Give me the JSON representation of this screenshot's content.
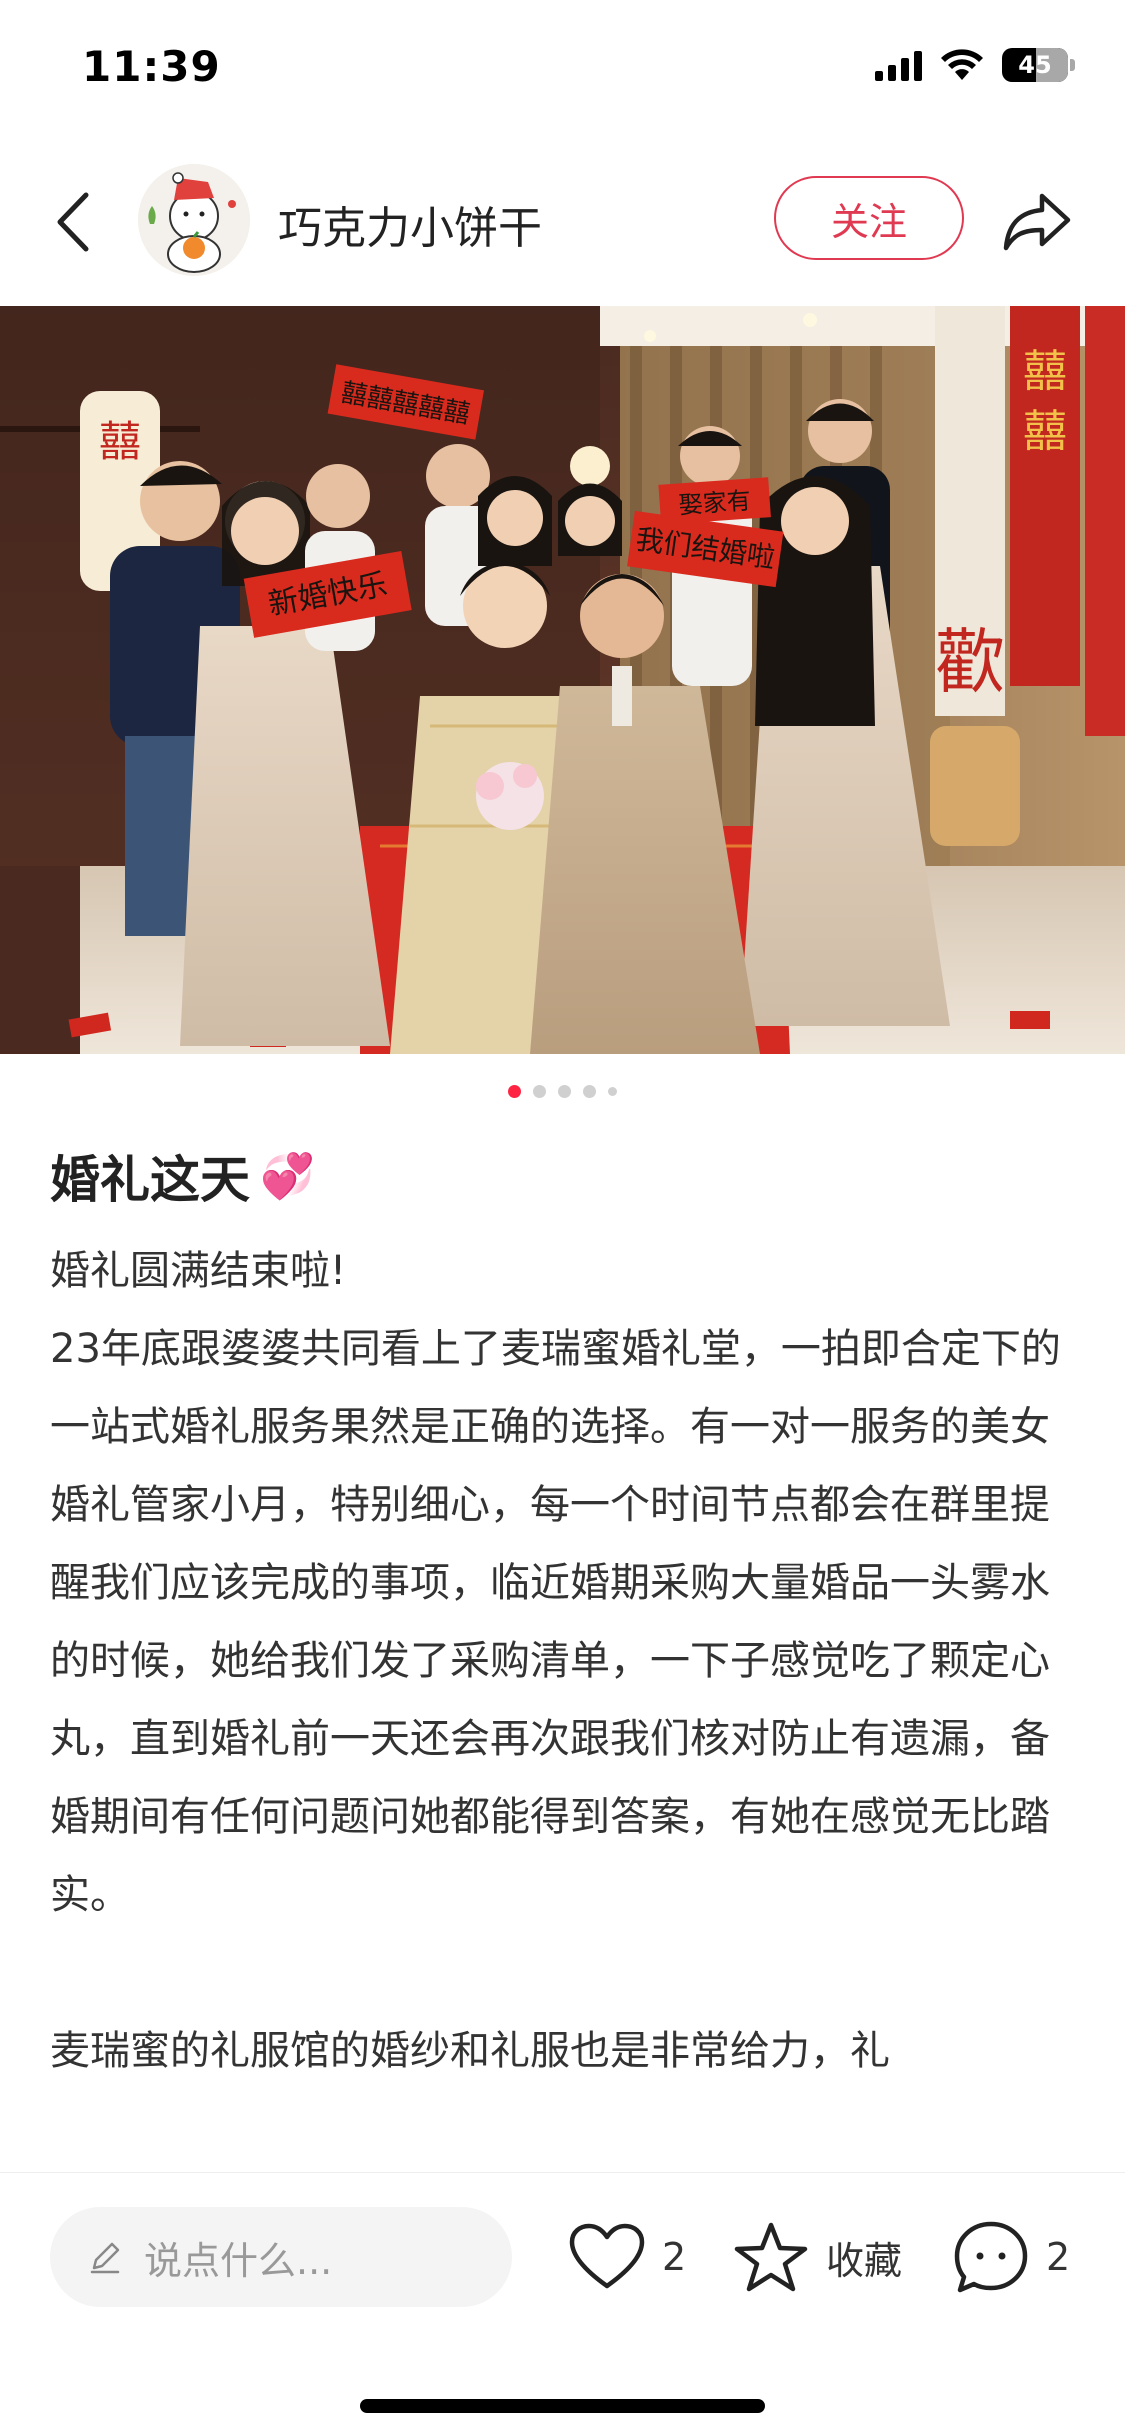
{
  "status_bar": {
    "time": "11:39",
    "battery": "45",
    "icons": [
      "signal-icon",
      "wifi-icon",
      "battery-icon"
    ]
  },
  "header": {
    "username": "巧克力小饼干",
    "follow_label": "关注",
    "icons": [
      "back-arrow-icon",
      "share-icon"
    ]
  },
  "photo": {
    "banner_left": "新婚快乐",
    "banner_top": "囍囍囍囍囍",
    "banner_right_top": "娶家有",
    "banner_right": "我们结婚啦",
    "lantern": "囍",
    "wall_big": "歡",
    "wall_scroll": "囍"
  },
  "carousel": {
    "count": 5,
    "active_index": 0
  },
  "post": {
    "title": "婚礼这天",
    "title_emoji": "💞",
    "body": "婚礼圆满结束啦!\n23年底跟婆婆共同看上了麦瑞蜜婚礼堂，一拍即合定下的一站式婚礼服务果然是正确的选择。有一对一服务的美女婚礼管家小月，特别细心，每一个时间节点都会在群里提醒我们应该完成的事项，临近婚期采购大量婚品一头雾水的时候，她给我们发了采购清单，一下子感觉吃了颗定心丸，直到婚礼前一天还会再次跟我们核对防止有遗漏，备婚期间有任何问题问她都能得到答案，有她在感觉无比踏实。\n\n麦瑞蜜的礼服馆的婚纱和礼服也是非常给力，礼"
  },
  "bottom_bar": {
    "comment_placeholder": "说点什么...",
    "like_count": "2",
    "collect_label": "收藏",
    "comment_count": "2",
    "icons": [
      "pencil-icon",
      "heart-icon",
      "star-icon",
      "comment-icon"
    ]
  },
  "colors": {
    "accent": "#ff2442",
    "follow": "#e03a52"
  }
}
